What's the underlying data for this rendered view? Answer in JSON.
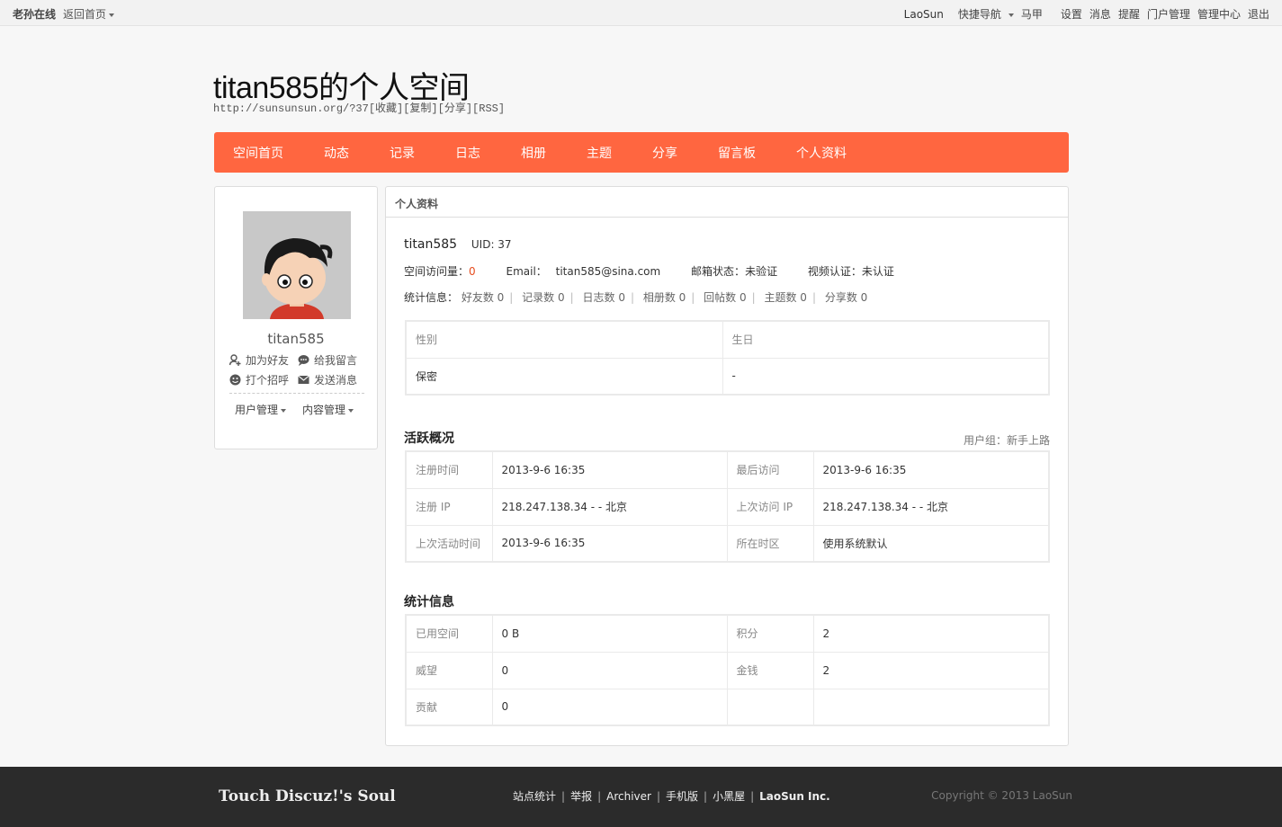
{
  "topbar": {
    "site_name": "老孙在线",
    "home_link": "返回首页",
    "brand": "LaoSun",
    "quick_nav": "快捷导航",
    "user": "马甲",
    "links": [
      "设置",
      "消息",
      "提醒",
      "门户管理",
      "管理中心",
      "退出"
    ]
  },
  "header": {
    "title": "titan585的个人空间",
    "url": "http://sunsunsun.org/?37",
    "actions": [
      "[收藏]",
      "[复制]",
      "[分享]",
      "[RSS]"
    ]
  },
  "nav": {
    "items": [
      "空间首页",
      "动态",
      "记录",
      "日志",
      "相册",
      "主题",
      "分享",
      "留言板",
      "个人资料"
    ]
  },
  "sidebar": {
    "username": "titan585",
    "actions": [
      "加为好友",
      "给我留言",
      "打个招呼",
      "发送消息"
    ],
    "menus": [
      "用户管理",
      "内容管理"
    ]
  },
  "profile": {
    "section_title": "个人资料",
    "name": "titan585",
    "uid": "UID: 37",
    "visits_label": "空间访问量：",
    "visits_value": "0",
    "email_label": "Email：",
    "email_value": "titan585@sina.com",
    "mail_status_label": "邮箱状态：",
    "mail_status_value": "未验证",
    "video_label": "视频认证：",
    "video_value": "未认证",
    "stats_label": "统计信息：",
    "stats": [
      "好友数 0",
      "记录数 0",
      "日志数 0",
      "相册数 0",
      "回帖数 0",
      "主题数 0",
      "分享数 0"
    ],
    "basic": {
      "headers": [
        "性别",
        "生日"
      ],
      "values": [
        "保密",
        "-"
      ]
    }
  },
  "activity": {
    "title": "活跃概况",
    "usergroup": "用户组：新手上路",
    "rows": [
      [
        "注册时间",
        "2013-9-6 16:35",
        "最后访问",
        "2013-9-6 16:35"
      ],
      [
        "注册 IP",
        "218.247.138.34 - - 北京",
        "上次访问 IP",
        "218.247.138.34 - - 北京"
      ],
      [
        "上次活动时间",
        "2013-9-6 16:35",
        "所在时区",
        "使用系统默认"
      ]
    ]
  },
  "statistics": {
    "title": "统计信息",
    "rows": [
      [
        "已用空间",
        "0 B",
        "积分",
        "2"
      ],
      [
        "威望",
        "0",
        "金钱",
        "2"
      ],
      [
        "贡献",
        "0",
        "",
        ""
      ]
    ]
  },
  "footer": {
    "slogan": "Touch Discuz!'s Soul",
    "links": [
      "站点统计",
      "举报",
      "Archiver",
      "手机版",
      "小黑屋",
      "LaoSun Inc."
    ],
    "copyright": "Copyright © 2013 LaoSun"
  },
  "colors": {
    "nav_bg": "#ff6640",
    "footer_bg": "#2b2b2b",
    "highlight": "#e64c1e"
  }
}
